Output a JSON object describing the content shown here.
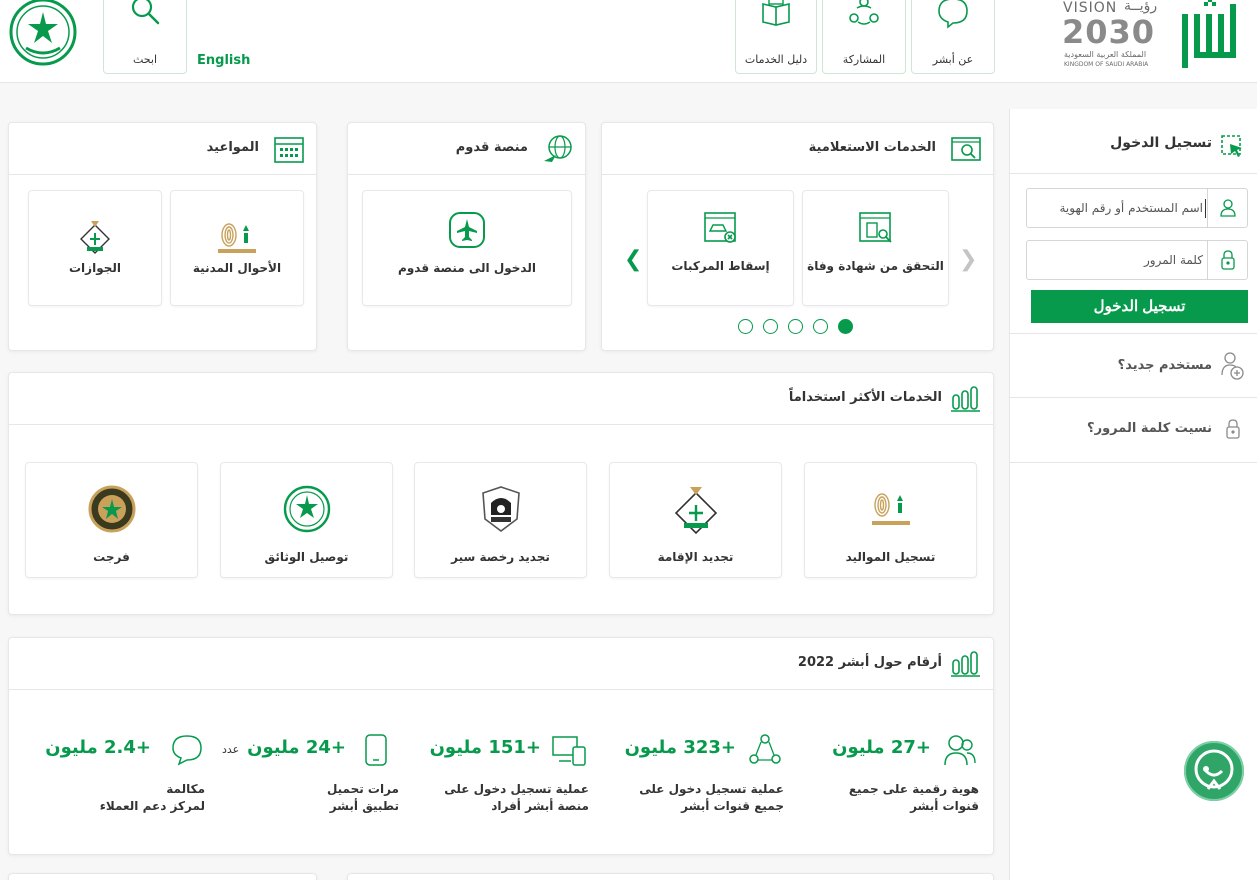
{
  "header": {
    "search_label": "ابحث",
    "english_label": "English",
    "nav": [
      {
        "label": "دليل الخدمات",
        "icon": "book-icon"
      },
      {
        "label": "المشاركة",
        "icon": "share-icon"
      },
      {
        "label": "عن أبشر",
        "icon": "chat-bubble-icon"
      }
    ],
    "vision_text": "VISION",
    "vision_ar": "رؤيــة",
    "vision_year": "2030",
    "vision_kingdom_ar": "المملكة العربية السعودية",
    "vision_kingdom_en": "KINGDOM OF SAUDI ARABIA"
  },
  "appointments": {
    "title": "المواعيد",
    "tiles": [
      {
        "label": "الأحوال المدنية"
      },
      {
        "label": "الجوازات"
      }
    ]
  },
  "arrival": {
    "title": "منصة قدوم",
    "tile_label": "الدخول الى منصة قدوم"
  },
  "inquiry": {
    "title": "الخدمات الاستعلامية",
    "tiles": [
      {
        "label": "التحقق من شهادة وفاة"
      },
      {
        "label": "إسقاط المركبات"
      }
    ],
    "dots": 5,
    "active_dot": 4
  },
  "most_used": {
    "title": "الخدمات الأكثر استخداماً",
    "tiles": [
      {
        "label": "تسجيل المواليد"
      },
      {
        "label": "تجديد الإقامة"
      },
      {
        "label": "تجديد رخصة سير"
      },
      {
        "label": "توصيل الوثائق"
      },
      {
        "label": "فرجت"
      }
    ]
  },
  "stats": {
    "title": "أرقام حول أبشر 2022",
    "items": [
      {
        "num": "+27 مليون",
        "unit": "",
        "desc1": "هوية رقمية على جميع",
        "desc2": "قنوات أبشر"
      },
      {
        "num": "+323 مليون",
        "unit": "",
        "desc1": "عملية تسجيل دخول على",
        "desc2": "جميع قنوات أبشر"
      },
      {
        "num": "+151 مليون",
        "unit": "",
        "desc1": "عملية تسجيل دخول على",
        "desc2": "منصة أبشر أفراد"
      },
      {
        "num": "+24 مليون",
        "unit": "عدد",
        "desc1": "مرات تحميل",
        "desc2": "تطبيق أبشر"
      },
      {
        "num": "+2.4 مليون",
        "unit": "",
        "desc1": "مكالمة",
        "desc2": "لمركز دعم العملاء"
      }
    ]
  },
  "login": {
    "title": "تسجيل الدخول",
    "username_placeholder": "اسم المستخدم أو رقم الهوية",
    "password_placeholder": "كلمة المرور",
    "submit_label": "تسجيل الدخول",
    "new_user": "مستخدم جديد؟",
    "forgot_password": "نسيت كلمة المرور؟"
  },
  "colors": {
    "brand": "#079a4c",
    "gold": "#c9a15a"
  }
}
